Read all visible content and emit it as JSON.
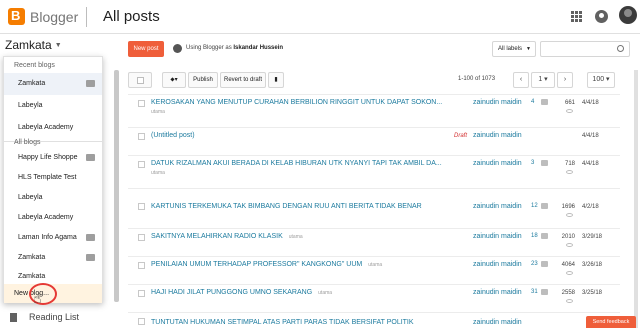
{
  "app": {
    "brand": "Blogger",
    "page_title": "All posts"
  },
  "blog_selector": {
    "current": "Zamkata"
  },
  "dropdown": {
    "recent_heading": "Recent blogs",
    "recent": [
      "Zamkata",
      "Labeyla",
      "Labeyla Academy"
    ],
    "all_heading": "All blogs",
    "all": [
      "Happy Life Shoppe",
      "HLS Template Test",
      "Labeyla",
      "Labeyla Academy",
      "Laman Info Agama",
      "Zamkata",
      "Zamkata"
    ],
    "new_blog": "New blog..."
  },
  "sidebar": {
    "reading_list": "Reading List"
  },
  "actions": {
    "new_post": "New post",
    "using_prefix": "Using Blogger as",
    "using_name": "Iskandar Hussein",
    "labels_filter": "All labels",
    "search_placeholder": ""
  },
  "toolbar": {
    "publish": "Publish",
    "revert": "Revert to draft",
    "range": "1-100 of 1073",
    "page": "1",
    "per_page": "100"
  },
  "posts": [
    {
      "title": "KEROSAKAN YANG MENUTUP CURAHAN BERBILION RINGGIT UNTUK DAPAT SOKON...",
      "snippet": "utama",
      "status": "",
      "author": "zainudin maidin",
      "comments": "4",
      "views": "661",
      "date": "4/4/18"
    },
    {
      "title": "(Untitled post)",
      "snippet": "",
      "status": "Draft",
      "author": "zainudin maidin",
      "comments": "",
      "views": "",
      "date": "4/4/18"
    },
    {
      "title": "DATUK RIZALMAN AKUI BERADA DI KELAB HIBURAN UTK NYANYI TAPI TAK AMBIL DA...",
      "snippet": "utama",
      "status": "",
      "author": "zainudin maidin",
      "comments": "3",
      "views": "718",
      "date": "4/4/18"
    },
    {
      "title": "KARTUNIS TERKEMUKA TAK BIMBANG DENGAN RUU ANTI BERITA TIDAK BENAR",
      "snippet": "",
      "status": "",
      "author": "zainudin maidin",
      "comments": "12",
      "views": "1696",
      "date": "4/2/18"
    },
    {
      "title": "SAKITNYA MELAHIRKAN RADIO KLASIK",
      "snippet": "",
      "inline_label": "utama",
      "status": "",
      "author": "zainudin maidin",
      "comments": "18",
      "views": "2010",
      "date": "3/29/18"
    },
    {
      "title": "PENILAIAN UMUM TERHADAP PROFESSOR\" KANGKONG\" UUM",
      "snippet": "",
      "inline_label": "utama",
      "status": "",
      "author": "zainudin maidin",
      "comments": "23",
      "views": "4064",
      "date": "3/26/18"
    },
    {
      "title": "HAJI HADI JILAT PUNGGONG UMNO SEKARANG",
      "snippet": "",
      "inline_label": "utama",
      "status": "",
      "author": "zainudin maidin",
      "comments": "31",
      "views": "2558",
      "date": "3/25/18"
    },
    {
      "title": "TUNTUTAN HUKUMAN SETIMPAL ATAS PARTI PARAS TIDAK BERSIFAT POLITIK",
      "snippet": "",
      "status": "",
      "author": "zainudin maidin",
      "comments": "",
      "views": "",
      "date": ""
    }
  ],
  "feedback": "Send feedback",
  "colors": {
    "accent": "#ef5e3a",
    "link": "#1b7a9e",
    "brand": "#f57d00"
  }
}
